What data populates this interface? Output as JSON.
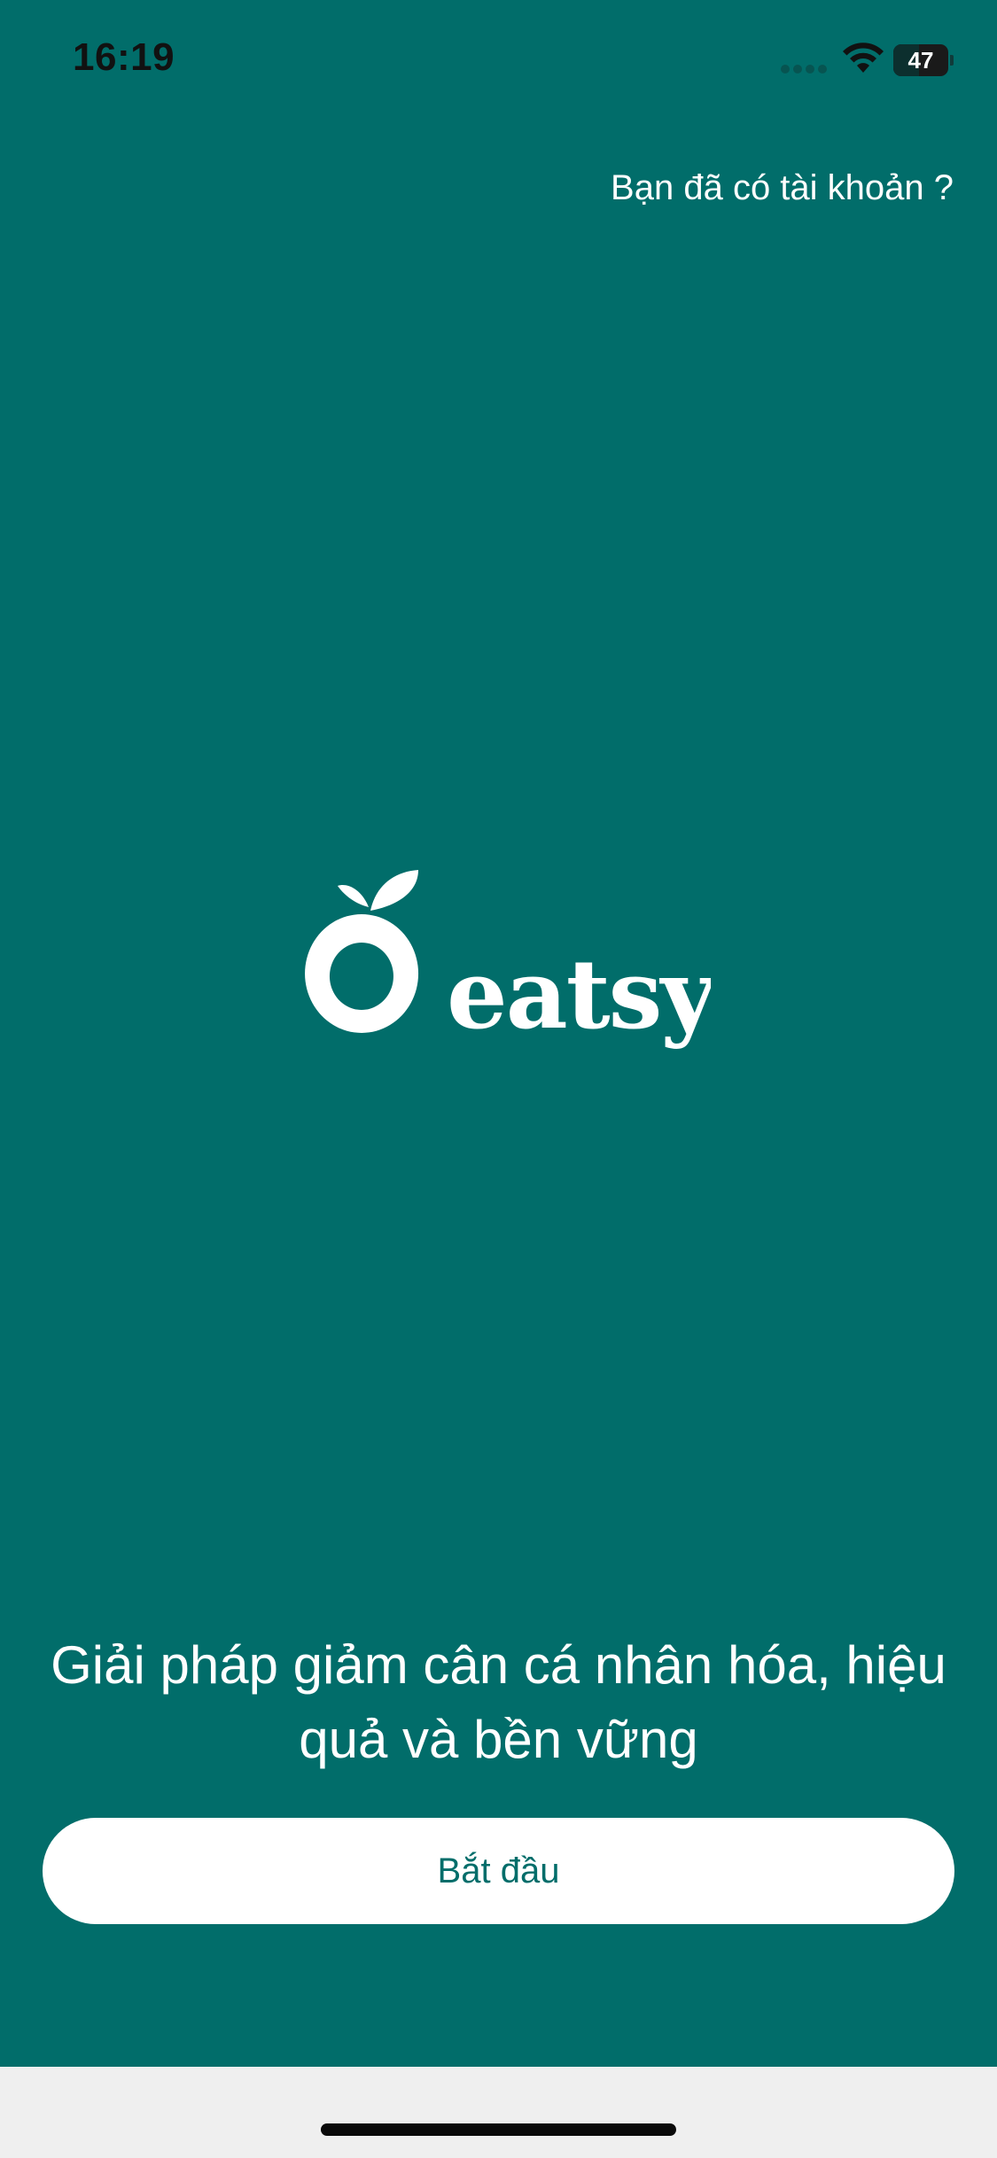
{
  "status_bar": {
    "time": "16:19",
    "battery_percent": 47,
    "battery_label": "47",
    "icons": [
      "signal-icon",
      "wifi-icon",
      "battery-icon"
    ]
  },
  "header": {
    "login_link": "Bạn đã có tài khoản ?"
  },
  "logo": {
    "brand_name": "eatsy"
  },
  "main": {
    "tagline": "Giải pháp giảm cân cá nhân hóa, hiệu quả và bền vững",
    "start_button": "Bắt đầu"
  },
  "colors": {
    "background": "#016d6a",
    "button_background": "#ffffff",
    "button_text": "#016d6a",
    "bottom_bar": "#efefef"
  }
}
